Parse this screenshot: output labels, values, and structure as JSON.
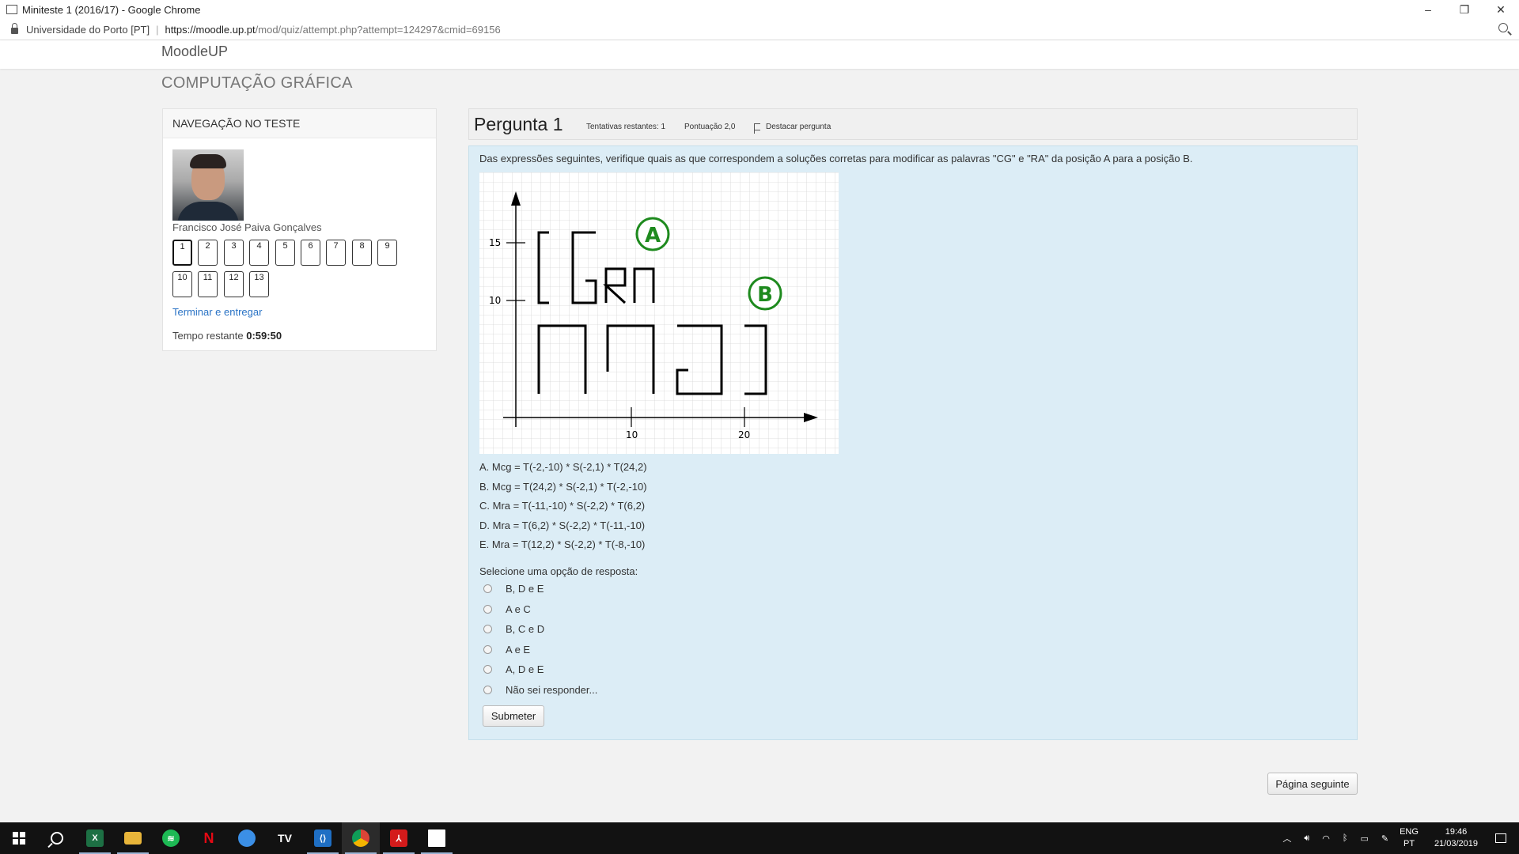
{
  "window": {
    "title": "Miniteste 1 (2016/17) - Google Chrome",
    "controls": [
      "–",
      "❐",
      "✕"
    ]
  },
  "address_bar": {
    "site_name": "Universidade do Porto [PT]",
    "url_host": "https://moodle.up.pt",
    "url_path": "/mod/quiz/attempt.php?attempt=124297&cmid=69156"
  },
  "header": {
    "brand": "MoodleUP",
    "course": "COMPUTAÇÃO GRÁFICA"
  },
  "quiz_nav": {
    "title": "NAVEGAÇÃO NO TESTE",
    "user_name": "Francisco José Paiva Gonçalves",
    "question_buttons": [
      "1",
      "2",
      "3",
      "4",
      "5",
      "6",
      "7",
      "8",
      "9",
      "10",
      "11",
      "12",
      "13"
    ],
    "current_question": "1",
    "finish_link": "Terminar e entregar",
    "time_label": "Tempo restante",
    "time_value": "0:59:50"
  },
  "question": {
    "number_label": "Pergunta",
    "number": "1",
    "state": "Tentativas restantes: 1",
    "grade": "Pontuação 2,0",
    "flag": "Destacar pergunta",
    "text": "Das expressões seguintes, verifique quais as que correspondem a soluções corretas para modificar as palavras \"CG\" e \"RA\" da posição A para a posição B.",
    "figure": {
      "y_ticks": [
        "15",
        "10"
      ],
      "x_ticks": [
        "10",
        "20"
      ],
      "marker_a": "A",
      "marker_b": "B"
    },
    "options": [
      "A.   Mcg = T(-2,-10) * S(-2,1) * T(24,2)",
      "B.   Mcg = T(24,2) * S(-2,1) * T(-2,-10)",
      "C.   Mra = T(-11,-10) * S(-2,2) * T(6,2)",
      "D.   Mra = T(6,2) * S(-2,2) * T(-11,-10)",
      "E.   Mra = T(12,2) * S(-2,2) * T(-8,-10)"
    ],
    "prompt": "Selecione uma opção de resposta:",
    "answers": [
      "B, D e E",
      "A e C",
      "B, C e D",
      "A e E",
      "A, D e E",
      "Não sei responder..."
    ],
    "submit": "Submeter"
  },
  "next_page": "Página seguinte",
  "taskbar": {
    "apps": [
      "windows-start",
      "search",
      "excel",
      "file-explorer",
      "spotify",
      "netflix",
      "messenger",
      "tv",
      "vscode",
      "chrome",
      "acrobat",
      "photos"
    ],
    "lang_top": "ENG",
    "lang_bottom": "PT",
    "time": "19:46",
    "date": "21/03/2019"
  }
}
